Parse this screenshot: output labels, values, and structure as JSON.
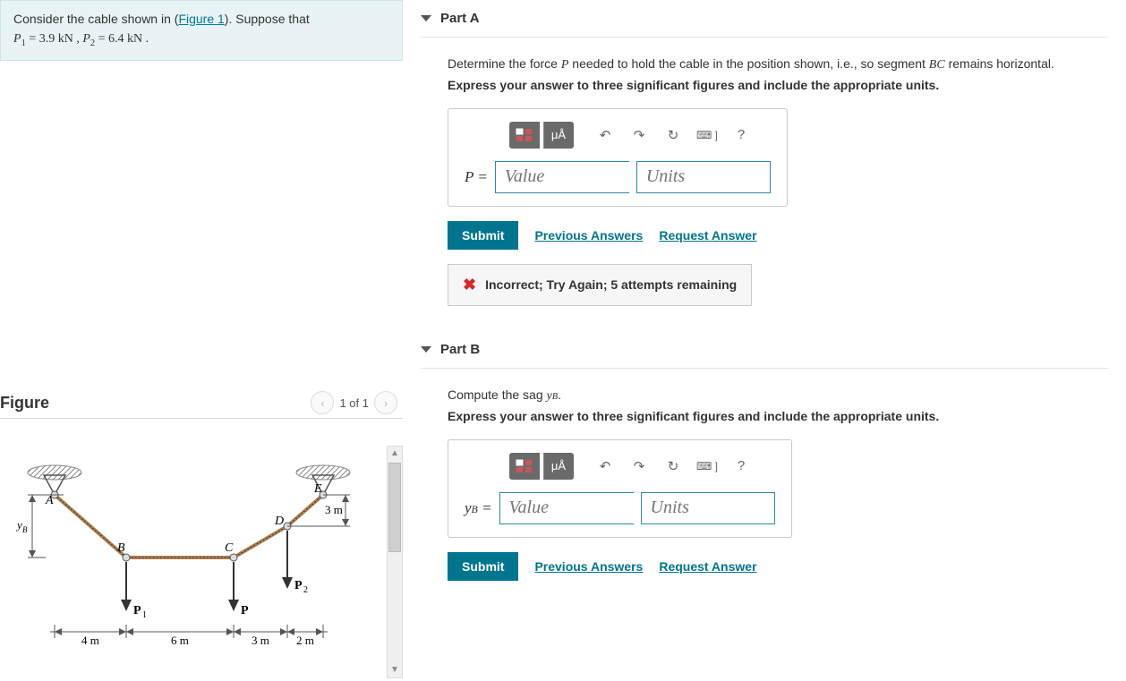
{
  "problem": {
    "prefix": "Consider the cable shown in (",
    "figure_link": "Figure 1",
    "suffix": "). Suppose that",
    "values_line_html": "P₁ = 3.9 kN , P₂ = 6.4 kN ."
  },
  "figure": {
    "title": "Figure",
    "pager_text": "1 of 1",
    "labels": {
      "A": "A",
      "B": "B",
      "C": "C",
      "D": "D",
      "E": "E",
      "yB": "yB",
      "P1": "P₁",
      "P": "P",
      "P2": "P₂",
      "d3m": "3 m",
      "d4m": "4 m",
      "d6m": "6 m",
      "d3m2": "3 m",
      "d2m": "2 m"
    }
  },
  "partA": {
    "title": "Part A",
    "question_pre": "Determine the force ",
    "question_var": "P",
    "question_mid": " needed to hold the cable in the position shown, i.e., so segment ",
    "question_seg": "BC",
    "question_post": " remains horizontal.",
    "instruction_bold": "Express your answer to three significant figures and include the appropriate units.",
    "eq_label": "P =",
    "value_placeholder": "Value",
    "units_placeholder": "Units",
    "submit": "Submit",
    "prev": "Previous Answers",
    "request": "Request Answer",
    "feedback": "Incorrect; Try Again; 5 attempts remaining"
  },
  "partB": {
    "title": "Part B",
    "question_pre": "Compute the sag ",
    "question_var": "yB",
    "question_post": ".",
    "instruction_bold": "Express your answer to three significant figures and include the appropriate units.",
    "eq_label": "yB =",
    "value_placeholder": "Value",
    "units_placeholder": "Units",
    "submit": "Submit",
    "prev": "Previous Answers",
    "request": "Request Answer"
  },
  "toolbar": {
    "templates_icon": "▭",
    "units_icon": "μÅ",
    "undo": "↶",
    "redo": "↷",
    "reset": "↻",
    "keyboard": "⌨ ]",
    "help": "?"
  }
}
